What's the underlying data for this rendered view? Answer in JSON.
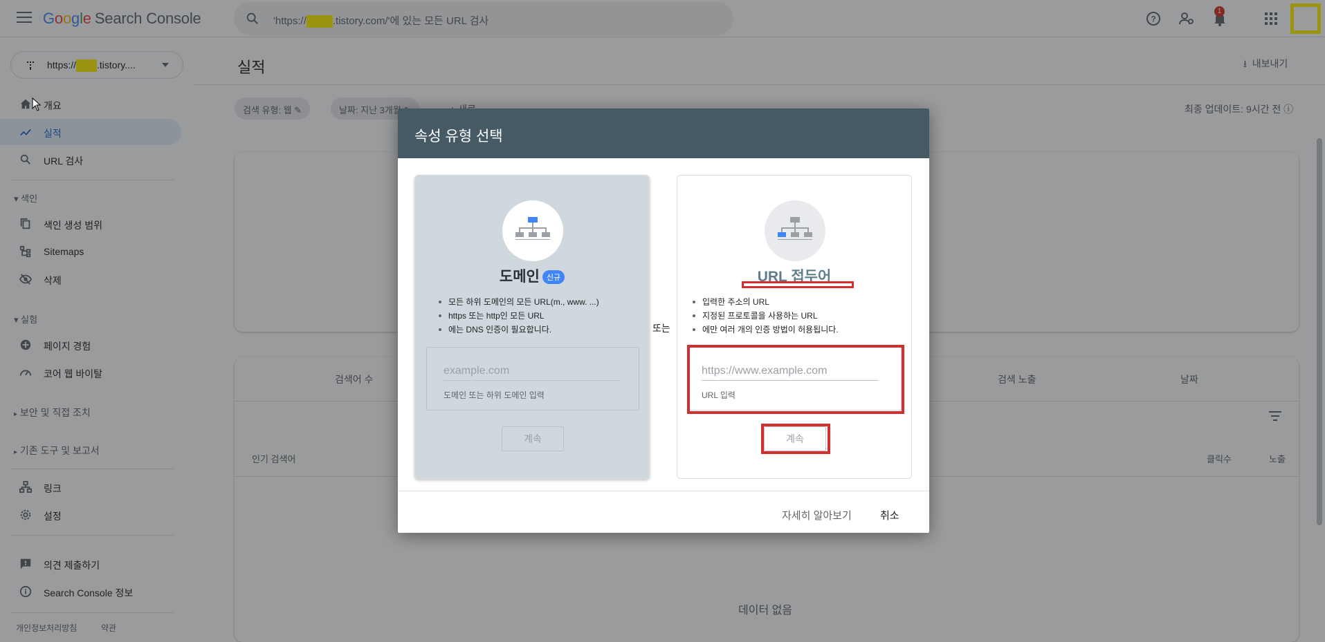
{
  "header": {
    "logo_google": [
      "G",
      "o",
      "o",
      "g",
      "l",
      "e"
    ],
    "logo_product": "Search Console",
    "search_prefix": "'https://",
    "search_suffix": ".tistory.com/'에 있는 모든 URL 검사",
    "notification_count": "1"
  },
  "property": {
    "prefix": "https://",
    "suffix": ".tistory...."
  },
  "sidebar": {
    "overview": "개요",
    "performance": "실적",
    "url_inspection": "URL 검사",
    "section_index": "색인",
    "coverage": "색인 생성 범위",
    "sitemaps": "Sitemaps",
    "removals": "삭제",
    "section_experience": "실험",
    "page_experience": "페이지 경험",
    "core_web_vitals": "코어 웹 바이탈",
    "security": "보안 및 직접 조치",
    "legacy": "기존 도구 및 보고서",
    "links": "링크",
    "settings": "설정",
    "feedback": "의견 제출하기",
    "about": "Search Console 정보",
    "privacy": "개인정보처리방침",
    "terms": "약관"
  },
  "main": {
    "title": "실적",
    "export": "내보내기",
    "chip_search_type": "검색 유형: 웹",
    "chip_date": "날짜: 지난 3개월",
    "chip_new": "+ 새로",
    "updated": "최종 업데이트: 9시간 전",
    "col_queries": "검색어 수",
    "col_impressions": "검색 노출",
    "col_date": "날짜",
    "top_queries": "인기 검색어",
    "clicks": "클릭수",
    "impressions": "노출",
    "no_data": "데이터 없음"
  },
  "dialog": {
    "title": "속성 유형 선택",
    "or": "또는",
    "domain": {
      "title": "도메인",
      "badge": "신규",
      "bullets": [
        "모든 하위 도메인의 모든 URL(m., www. ...)",
        "https 또는 http인 모든 URL",
        "에는 DNS 인증이 필요합니다."
      ],
      "placeholder": "example.com",
      "hint": "도메인 또는 하위 도메인 입력",
      "continue": "계속"
    },
    "url_prefix": {
      "title": "URL 접두어",
      "bullets": [
        "입력한 주소의 URL",
        "지정된 프로토콜을 사용하는 URL",
        "에만 여러 개의 인증 방법이 허용됩니다."
      ],
      "placeholder": "https://www.example.com",
      "hint": "URL 입력",
      "continue": "계속"
    },
    "learn_more": "자세히 알아보기",
    "cancel": "취소"
  },
  "colors": {
    "dialog_header": "#455a64",
    "highlight": "#fff200",
    "annotation_red": "#d32f2f",
    "active_nav": "#e8f0fe"
  }
}
